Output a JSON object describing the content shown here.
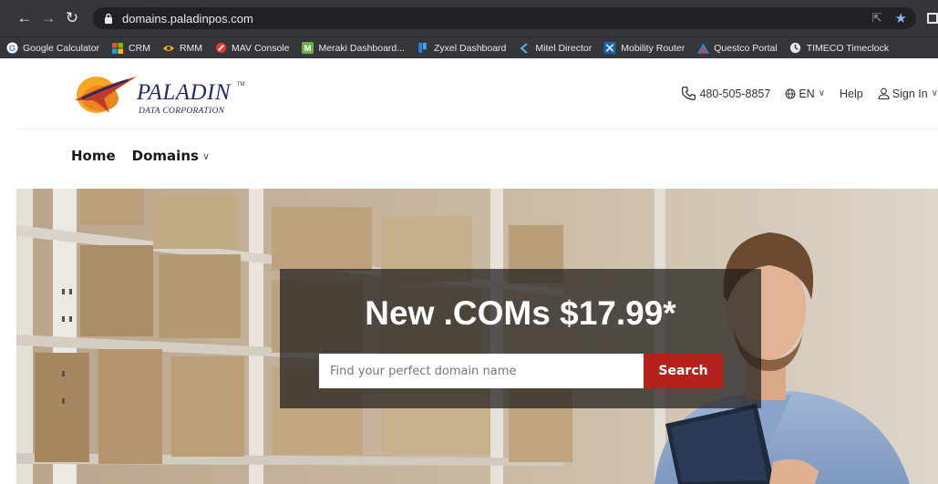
{
  "browser": {
    "url": "domains.paladinpos.com",
    "bookmarks": [
      {
        "label": "Google Calculator",
        "icon": "google-icon"
      },
      {
        "label": "CRM",
        "icon": "windows-icon"
      },
      {
        "label": "RMM",
        "icon": "rmm-icon"
      },
      {
        "label": "MAV Console",
        "icon": "mav-icon"
      },
      {
        "label": "Meraki Dashboard...",
        "icon": "meraki-icon"
      },
      {
        "label": "Zyxel Dashboard",
        "icon": "zyxel-icon"
      },
      {
        "label": "Mitel Director",
        "icon": "mitel-icon"
      },
      {
        "label": "Mobility Router",
        "icon": "mobility-icon"
      },
      {
        "label": "Questco Portal",
        "icon": "questco-icon"
      },
      {
        "label": "TIMECO Timeclock",
        "icon": "timeco-icon"
      }
    ]
  },
  "header": {
    "brand": "PALADIN",
    "trademark": "TM",
    "subtitle": "DATA CORPORATION",
    "phone": "480-505-8857",
    "language": "EN",
    "help": "Help",
    "sign_in": "Sign In"
  },
  "nav": {
    "home": "Home",
    "domains": "Domains"
  },
  "hero": {
    "headline": "New .COMs $17.99*",
    "search_placeholder": "Find your perfect domain name",
    "search_button": "Search"
  },
  "colors": {
    "browser_chrome": "#35363a",
    "brand_navy": "#232b66",
    "brand_orange": "#f5a623",
    "brand_red": "#c0392b",
    "search_button": "#b5221b"
  }
}
